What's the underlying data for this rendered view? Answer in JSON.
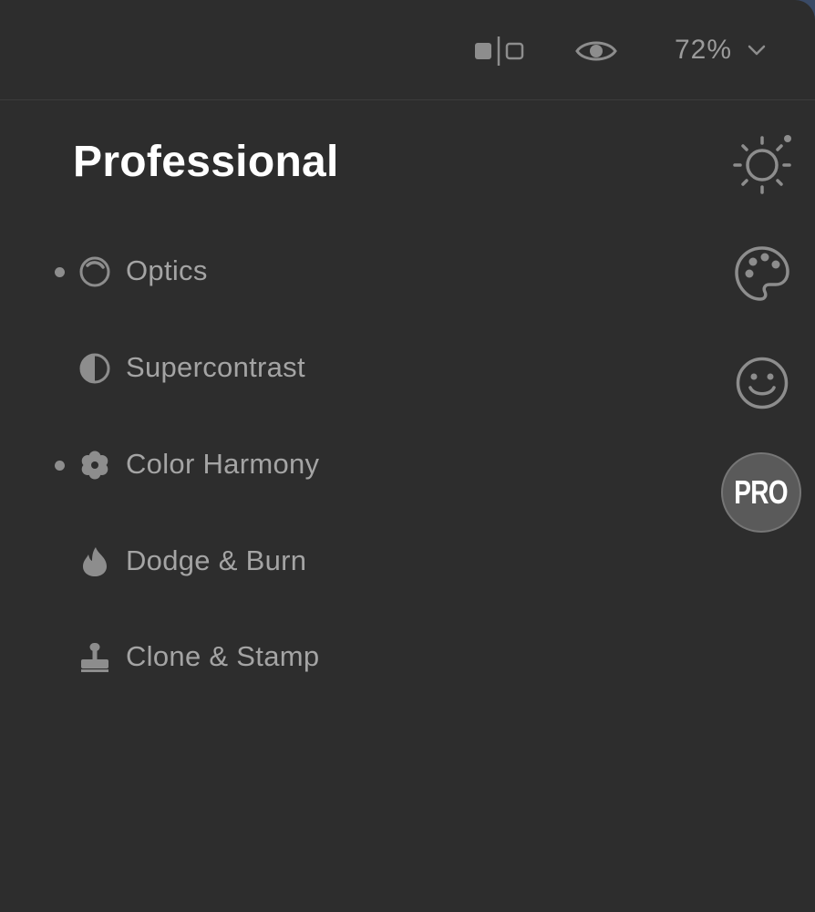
{
  "toolbar": {
    "compare_icon": "split-compare-icon",
    "preview_icon": "eye-icon",
    "zoom_value": "72%",
    "zoom_chevron_icon": "chevron-down-icon"
  },
  "panel": {
    "title": "Professional"
  },
  "tools": [
    {
      "label": "Optics",
      "icon": "optics-ring-icon",
      "active_dot": true
    },
    {
      "label": "Supercontrast",
      "icon": "half-circle-icon",
      "active_dot": false
    },
    {
      "label": "Color Harmony",
      "icon": "flower-icon",
      "active_dot": true
    },
    {
      "label": "Dodge & Burn",
      "icon": "flame-icon",
      "active_dot": false
    },
    {
      "label": "Clone & Stamp",
      "icon": "stamp-icon",
      "active_dot": false
    }
  ],
  "side_tabs": [
    {
      "icon": "sun-icon"
    },
    {
      "icon": "palette-icon"
    },
    {
      "icon": "smiley-face-icon"
    },
    {
      "label": "PRO",
      "selected": true
    }
  ],
  "colors": {
    "background": "#2d2d2d",
    "title": "#ffffff",
    "label": "#a4a4a4",
    "icon": "#8d8d8d",
    "pro_badge": "#5a5a5a"
  }
}
